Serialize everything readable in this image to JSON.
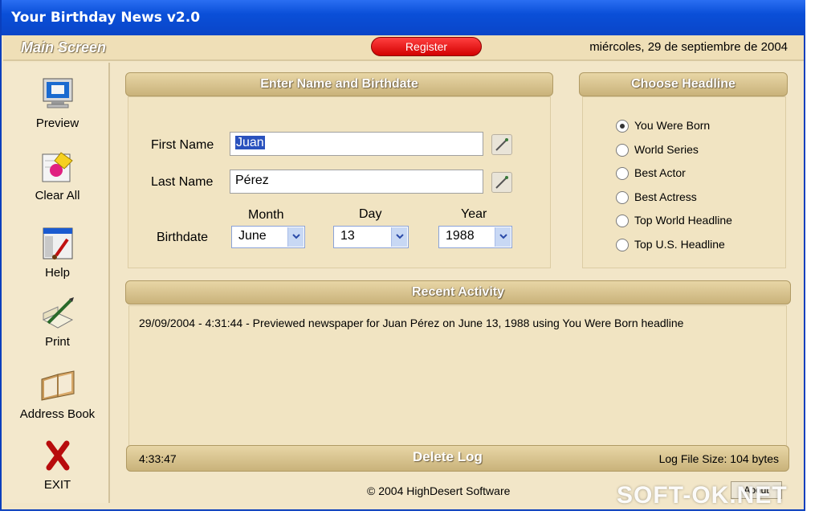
{
  "window": {
    "title": "Your Birthday News v2.0"
  },
  "statusbar": {
    "screen_name": "Main Screen",
    "register_label": "Register",
    "date": "miércoles, 29 de septiembre de 2004"
  },
  "sidebar": {
    "items": [
      {
        "label": "Preview",
        "icon": "monitor-icon"
      },
      {
        "label": "Clear All",
        "icon": "eraser-icon"
      },
      {
        "label": "Help",
        "icon": "help-icon"
      },
      {
        "label": "Print",
        "icon": "print-icon"
      },
      {
        "label": "Address Book",
        "icon": "address-book-icon"
      },
      {
        "label": "EXIT",
        "icon": "exit-x-icon"
      }
    ]
  },
  "name_panel": {
    "header": "Enter Name and Birthdate",
    "first_name_label": "First Name",
    "first_name_value": "Juan",
    "last_name_label": "Last Name",
    "last_name_value": "Pérez",
    "birthdate_label": "Birthdate",
    "month_label": "Month",
    "day_label": "Day",
    "year_label": "Year",
    "month_value": "June",
    "day_value": "13",
    "year_value": "1988"
  },
  "headline_panel": {
    "header": "Choose Headline",
    "options": [
      {
        "label": "You Were Born",
        "selected": true
      },
      {
        "label": "World Series",
        "selected": false
      },
      {
        "label": "Best Actor",
        "selected": false
      },
      {
        "label": "Best Actress",
        "selected": false
      },
      {
        "label": "Top World Headline",
        "selected": false
      },
      {
        "label": "Top U.S. Headline",
        "selected": false
      }
    ]
  },
  "activity": {
    "header": "Recent Activity",
    "entries": [
      "29/09/2004 - 4:31:44  - Previewed newspaper for Juan Pérez on June 13, 1988 using You Were Born headline"
    ],
    "time": "4:33:47",
    "delete_label": "Delete Log",
    "log_size": "Log File Size: 104 bytes"
  },
  "footer": {
    "copyright": "© 2004 HighDesert Software",
    "about_label": "About"
  },
  "watermark": "SOFT-OK.NET",
  "colors": {
    "titlebar": "#0a4fd8",
    "background": "#f2e6c8",
    "header_gold": "#c9b27a",
    "register_red": "#d20000"
  }
}
